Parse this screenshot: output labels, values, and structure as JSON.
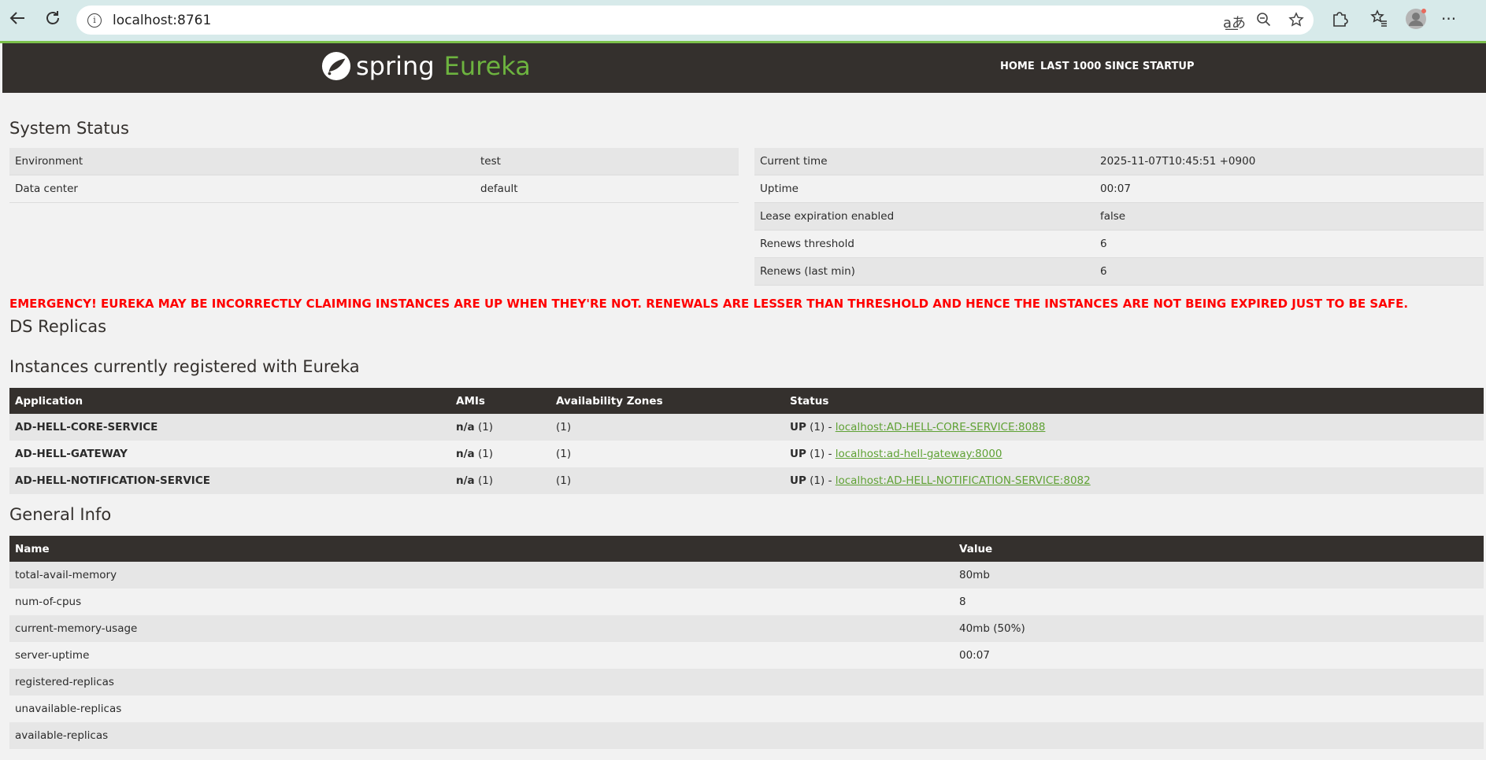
{
  "browser": {
    "url": "localhost:8761"
  },
  "header": {
    "logo_spring": "spring",
    "logo_eureka": "Eureka",
    "nav": [
      "HOME",
      "LAST 1000 SINCE STARTUP"
    ]
  },
  "system_status": {
    "title": "System Status",
    "left": [
      {
        "label": "Environment",
        "value": "test"
      },
      {
        "label": "Data center",
        "value": "default"
      }
    ],
    "right": [
      {
        "label": "Current time",
        "value": "2025-11-07T10:45:51 +0900"
      },
      {
        "label": "Uptime",
        "value": "00:07"
      },
      {
        "label": "Lease expiration enabled",
        "value": "false"
      },
      {
        "label": "Renews threshold",
        "value": "6"
      },
      {
        "label": "Renews (last min)",
        "value": "6"
      }
    ]
  },
  "emergency": "EMERGENCY! EUREKA MAY BE INCORRECTLY CLAIMING INSTANCES ARE UP WHEN THEY'RE NOT. RENEWALS ARE LESSER THAN THRESHOLD AND HENCE THE INSTANCES ARE NOT BEING EXPIRED JUST TO BE SAFE.",
  "ds_replicas": {
    "title": "DS Replicas"
  },
  "instances": {
    "title": "Instances currently registered with Eureka",
    "headers": [
      "Application",
      "AMIs",
      "Availability Zones",
      "Status"
    ],
    "rows": [
      {
        "app": "AD-HELL-CORE-SERVICE",
        "ami_bold": "n/a",
        "ami_count": "(1)",
        "zones": "(1)",
        "status_prefix": "UP",
        "status_count": "(1) -",
        "link": "localhost:AD-HELL-CORE-SERVICE:8088"
      },
      {
        "app": "AD-HELL-GATEWAY",
        "ami_bold": "n/a",
        "ami_count": "(1)",
        "zones": "(1)",
        "status_prefix": "UP",
        "status_count": "(1) -",
        "link": "localhost:ad-hell-gateway:8000"
      },
      {
        "app": "AD-HELL-NOTIFICATION-SERVICE",
        "ami_bold": "n/a",
        "ami_count": "(1)",
        "zones": "(1)",
        "status_prefix": "UP",
        "status_count": "(1) -",
        "link": "localhost:AD-HELL-NOTIFICATION-SERVICE:8082"
      }
    ]
  },
  "general_info": {
    "title": "General Info",
    "headers": [
      "Name",
      "Value"
    ],
    "rows": [
      {
        "name": "total-avail-memory",
        "value": "80mb"
      },
      {
        "name": "num-of-cpus",
        "value": "8"
      },
      {
        "name": "current-memory-usage",
        "value": "40mb (50%)"
      },
      {
        "name": "server-uptime",
        "value": "00:07"
      },
      {
        "name": "registered-replicas",
        "value": ""
      },
      {
        "name": "unavailable-replicas",
        "value": ""
      },
      {
        "name": "available-replicas",
        "value": ""
      }
    ]
  }
}
